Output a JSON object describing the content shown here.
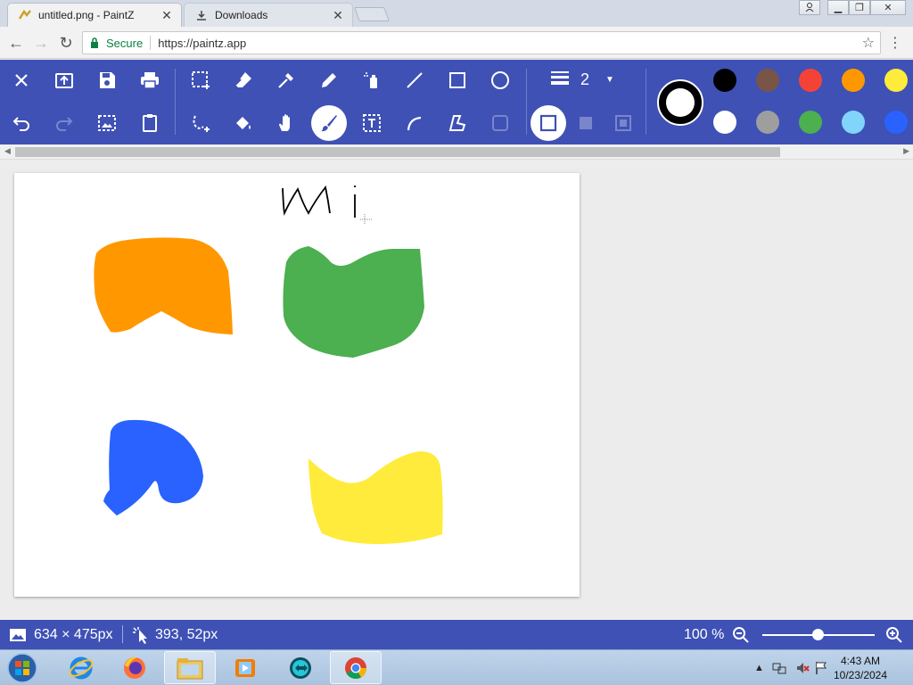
{
  "browser": {
    "tabs": [
      {
        "title": "untitled.png - PaintZ",
        "active": true
      },
      {
        "title": "Downloads",
        "active": false
      }
    ],
    "omnibox": {
      "secure_label": "Secure",
      "url": "https://paintz.app"
    }
  },
  "toolbar": {
    "line_width": "2",
    "colors": {
      "primary_bg": "#3f51b5",
      "swatches_row1": [
        "#000000",
        "#795548",
        "#f44336",
        "#ff9800",
        "#ffeb3b"
      ],
      "swatches_row2": [
        "#ffffff",
        "#9e9e9e",
        "#4caf50",
        "#81d4fa",
        "#2962ff"
      ]
    }
  },
  "canvas": {
    "text_sketch": "Wi",
    "shapes": [
      {
        "name": "orange-blob",
        "color": "#ff9800"
      },
      {
        "name": "green-blob",
        "color": "#4caf50"
      },
      {
        "name": "blue-blob",
        "color": "#2962ff"
      },
      {
        "name": "yellow-blob",
        "color": "#ffeb3b"
      }
    ]
  },
  "status": {
    "image_size": "634 × 475px",
    "cursor_pos": "393, 52px",
    "zoom": "100 %"
  },
  "taskbar": {
    "time": "4:43 AM",
    "date": "10/23/2024"
  }
}
